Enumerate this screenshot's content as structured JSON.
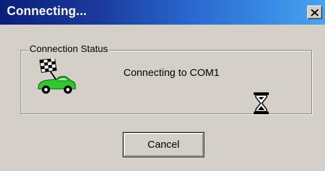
{
  "window": {
    "title": "Connecting..."
  },
  "groupbox": {
    "label": "Connection Status"
  },
  "status": {
    "message": "Connecting to COM1"
  },
  "buttons": {
    "cancel_label": "Cancel"
  },
  "icons": {
    "close": "close-icon",
    "car": "race-car-checkered-flag-icon",
    "hourglass": "hourglass-icon"
  },
  "colors": {
    "titlebar_start": "#0a1f7a",
    "titlebar_end": "#4aa4ef",
    "title_text": "#ffffff",
    "dialog_bg": "#d4d0c8",
    "car_body": "#2ec92e"
  }
}
